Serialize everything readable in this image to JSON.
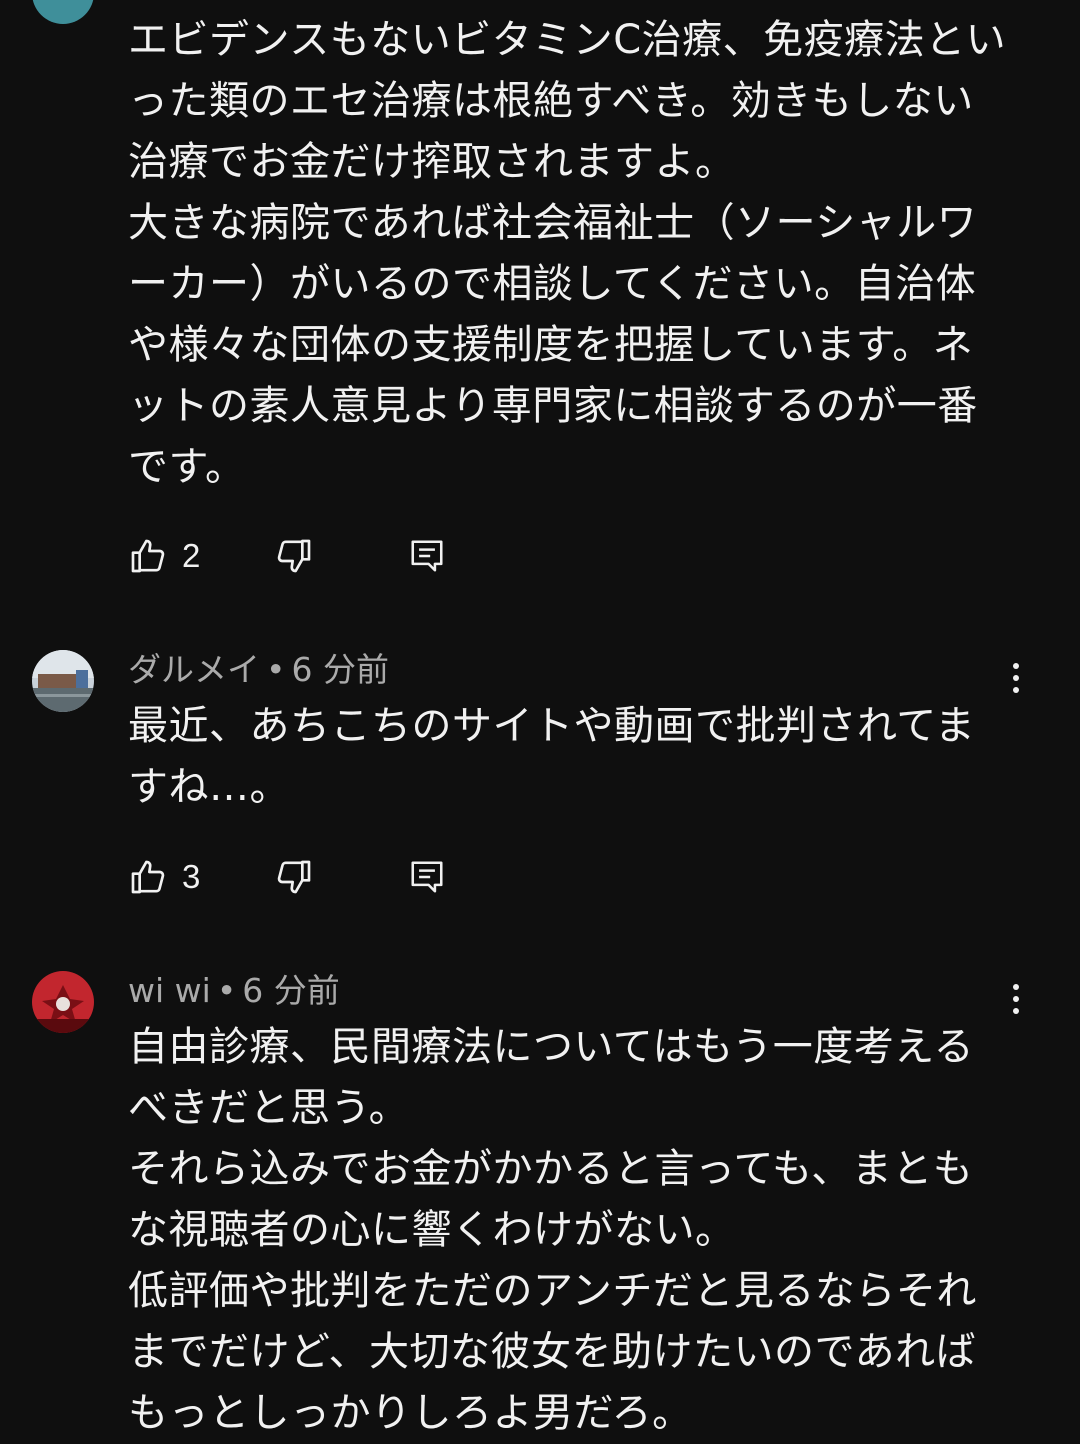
{
  "comments": [
    {
      "author": "",
      "time": "",
      "text": "エビデンスもないビタミンC治療、免疫療法といった類のエセ治療は根絶すべき。効きもしない治療でお金だけ搾取されますよ。\n大きな病院であれば社会福祉士（ソーシャルワーカー）がいるので相談してください。自治体や様々な団体の支援制度を把握しています。ネットの素人意見より専門家に相談するのが一番です。",
      "likes": "2"
    },
    {
      "author": "ダルメイ",
      "separator": "•",
      "time": "6 分前",
      "text": "最近、あちこちのサイトや動画で批判されてますね…。",
      "likes": "3"
    },
    {
      "author": "wi wi",
      "separator": "•",
      "time": "6 分前",
      "text": "自由診療、民間療法についてはもう一度考えるべきだと思う。\nそれら込みでお金がかかると言っても、まともな視聴者の心に響くわけがない。\n低評価や批判をただのアンチだと見るならそれまでだけど、大切な彼女を助けたいのであればもっとしっかりしろよ男だろ。",
      "likes": ""
    }
  ],
  "icons": {
    "like": "thumb-up-icon",
    "dislike": "thumb-down-icon",
    "reply": "reply-comment-icon",
    "more": "more-vert-icon"
  },
  "colors": {
    "background": "#0f0f0f",
    "text": "#f1f1f1",
    "meta": "#aaaaaa"
  }
}
